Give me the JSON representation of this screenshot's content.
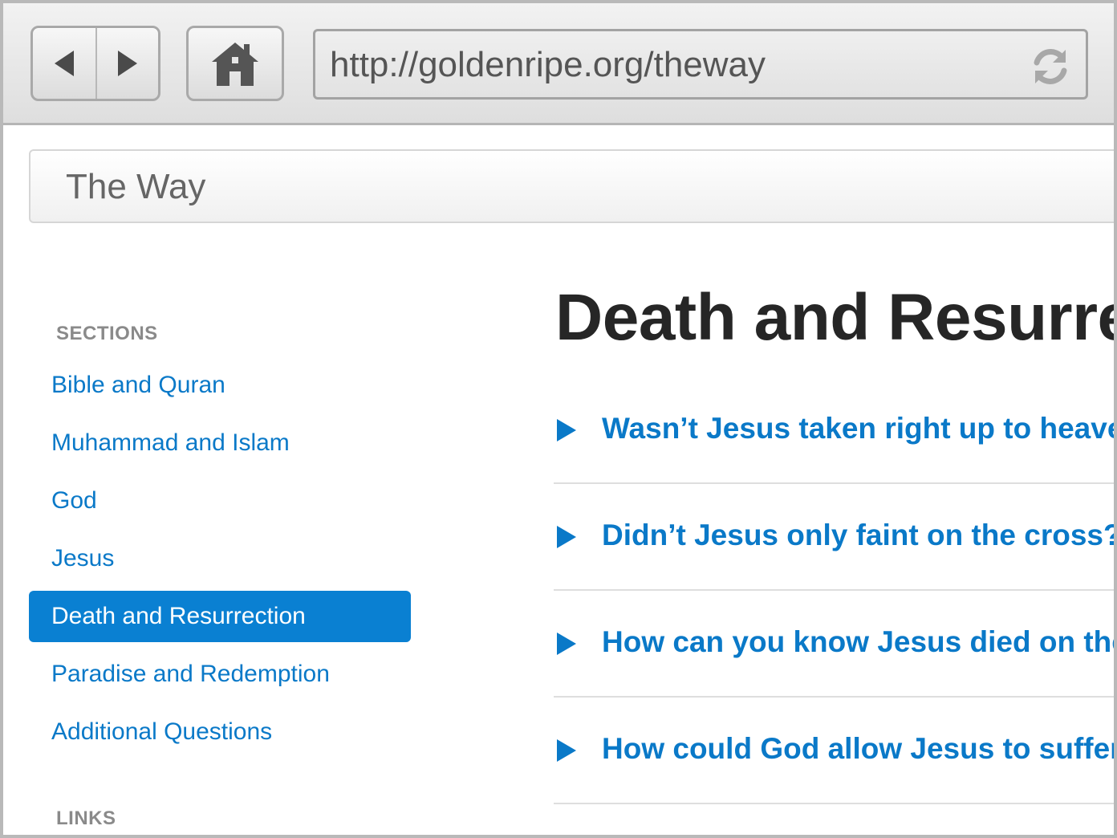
{
  "browser": {
    "url": "http://goldenripe.org/theway",
    "icons": {
      "back": "back-arrow-icon",
      "forward": "forward-arrow-icon",
      "home": "home-icon",
      "reload": "reload-icon"
    }
  },
  "header": {
    "site_title": "The Way"
  },
  "sidebar": {
    "sections_heading": "SECTIONS",
    "items": [
      {
        "label": "Bible and Quran",
        "active": false
      },
      {
        "label": "Muhammad and Islam",
        "active": false
      },
      {
        "label": "God",
        "active": false
      },
      {
        "label": "Jesus",
        "active": false
      },
      {
        "label": "Death and Resurrection",
        "active": true
      },
      {
        "label": "Paradise and Redemption",
        "active": false
      },
      {
        "label": "Additional Questions",
        "active": false
      }
    ],
    "links_heading": "LINKS"
  },
  "main": {
    "title": "Death and Resurrection",
    "questions": [
      "Wasn’t Jesus taken right up to heaven?",
      "Didn’t Jesus only faint on the cross?",
      "How can you know Jesus died on the cross?",
      "How could God allow Jesus to suffer?"
    ]
  },
  "colors": {
    "link": "#0a79c8",
    "active_bg": "#0a80d2",
    "title_text": "#262626"
  }
}
